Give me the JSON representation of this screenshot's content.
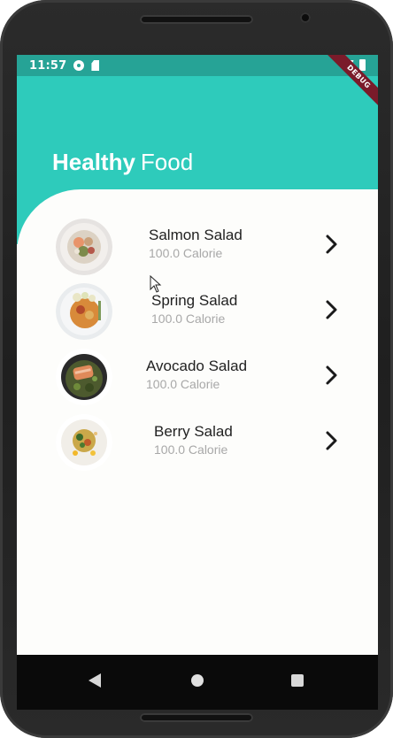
{
  "status_bar": {
    "time": "11:57",
    "left_icons": [
      "gear-icon",
      "sd-card-icon"
    ],
    "right_icons": [
      "wifi-icon",
      "battery-icon"
    ],
    "color": "#26a396"
  },
  "debug_banner": "DEBUG",
  "header": {
    "title_bold": "Healthy",
    "title_light": "Food",
    "color": "#2ecbbb"
  },
  "items": [
    {
      "name": "Salmon Salad",
      "calories": "100.0 Calorie",
      "icon": "chevron-right-icon"
    },
    {
      "name": "Spring Salad",
      "calories": "100.0 Calorie",
      "icon": "chevron-right-icon"
    },
    {
      "name": "Avocado Salad",
      "calories": "100.0 Calorie",
      "icon": "chevron-right-icon"
    },
    {
      "name": "Berry Salad",
      "calories": "100.0 Calorie",
      "icon": "chevron-right-icon"
    }
  ],
  "nav_bar": {
    "icons": [
      "back-icon",
      "home-icon",
      "recent-apps-icon"
    ]
  }
}
